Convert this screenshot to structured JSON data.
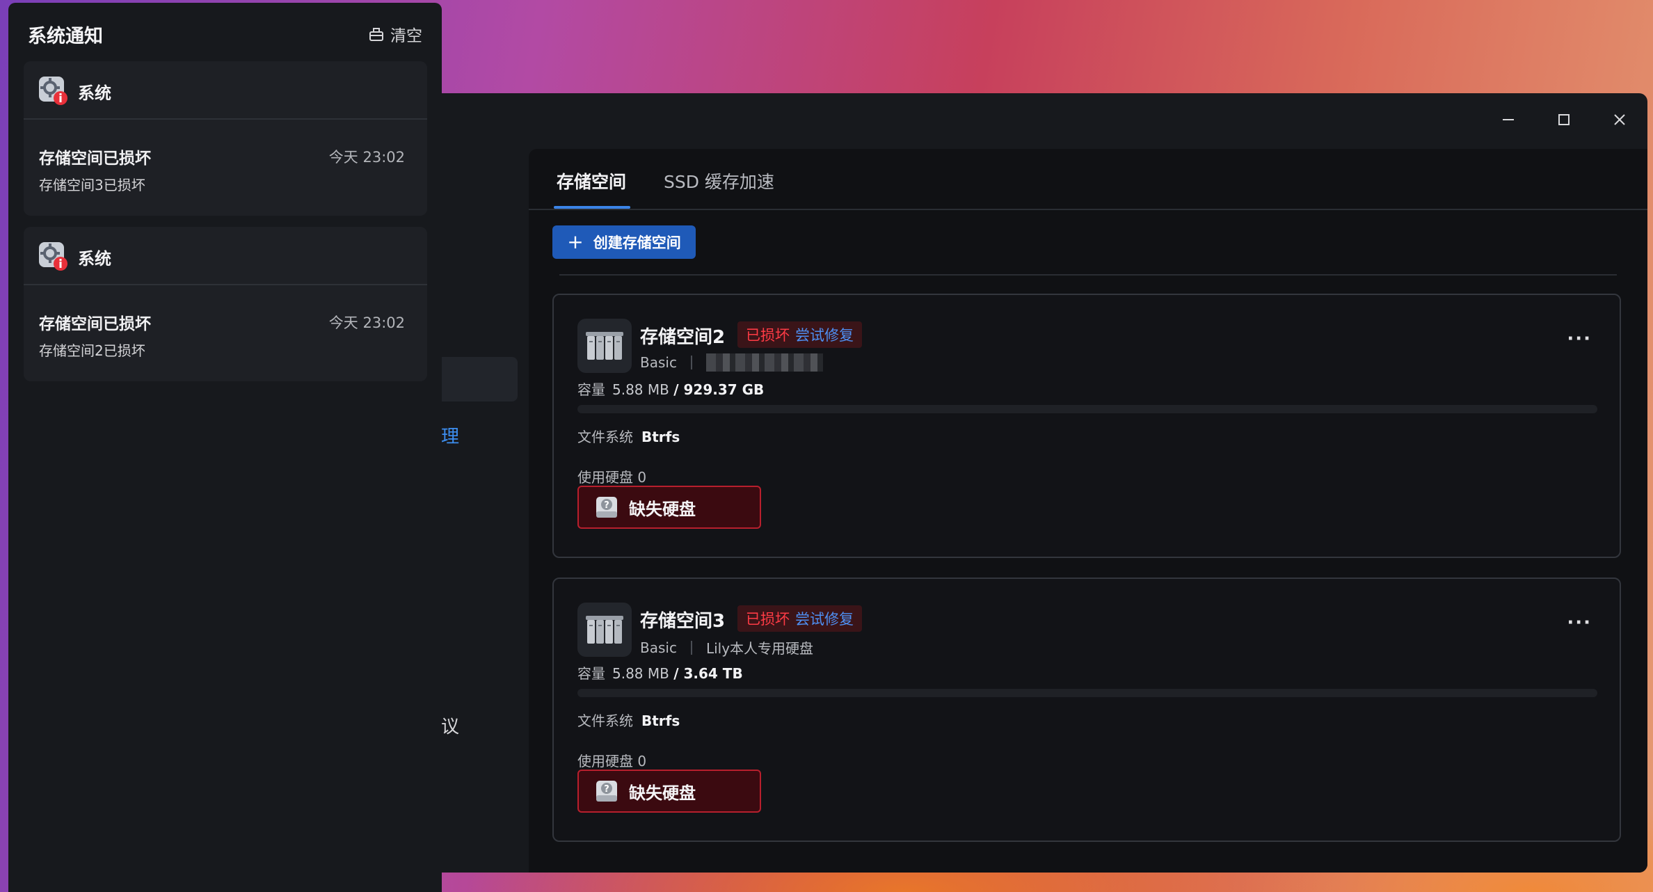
{
  "notifications": {
    "title": "系统通知",
    "clear_label": "清空",
    "items": [
      {
        "source": "系统",
        "title": "存储空间已损坏",
        "time": "今天 23:02",
        "body": "存储空间3已损坏"
      },
      {
        "source": "系统",
        "title": "存储空间已损坏",
        "time": "今天 23:02",
        "body": "存储空间2已损坏"
      }
    ]
  },
  "sidebar": {
    "items": [
      {
        "label": "理"
      },
      {
        "label": "议"
      }
    ]
  },
  "tabs": [
    {
      "label": "存储空间"
    },
    {
      "label": "SSD 缓存加速"
    }
  ],
  "toolbar": {
    "create_label": "创建存储空间"
  },
  "pools": [
    {
      "name": "存储空间2",
      "status": "已损坏",
      "repair_label": "尝试修复",
      "type": "Basic",
      "description": "",
      "capacity_label": "容量",
      "used": "5.88 MB",
      "total": "/ 929.37 GB",
      "usage_fraction": 0.0,
      "fs_label": "文件系统",
      "fs_value": "Btrfs",
      "disks_label": "使用硬盘 0",
      "missing_disk_label": "缺失硬盘"
    },
    {
      "name": "存储空间3",
      "status": "已损坏",
      "repair_label": "尝试修复",
      "type": "Basic",
      "description": "Lily本人专用硬盘",
      "capacity_label": "容量",
      "used": "5.88 MB",
      "total": "/ 3.64 TB",
      "usage_fraction": 0.0,
      "fs_label": "文件系统",
      "fs_value": "Btrfs",
      "disks_label": "使用硬盘 0",
      "missing_disk_label": "缺失硬盘"
    }
  ],
  "colors": {
    "accent": "#3b84e6",
    "danger": "#ff3b45",
    "link": "#4e8ff2"
  }
}
